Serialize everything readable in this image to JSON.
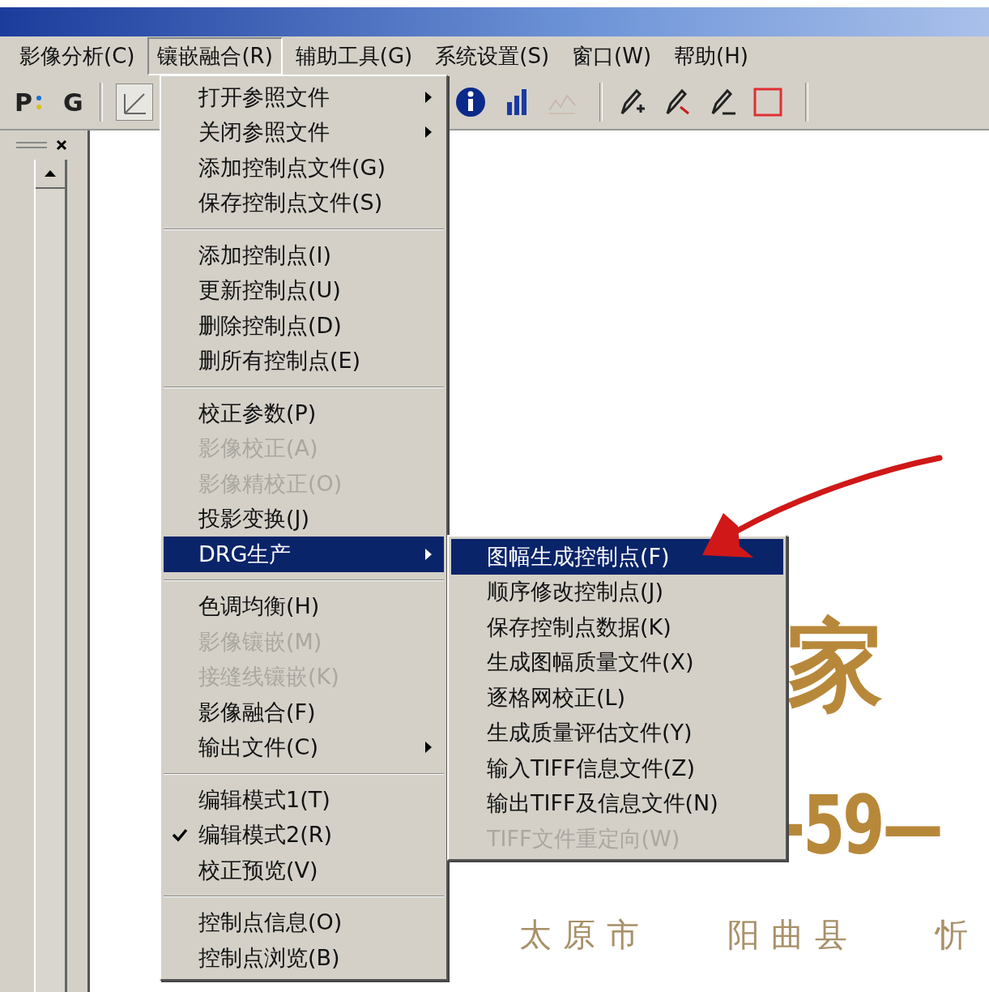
{
  "menu_bar": [
    {
      "label": "影像分析(C)",
      "selected": false
    },
    {
      "label": "镶嵌融合(R)",
      "selected": true
    },
    {
      "label": "辅助工具(G)",
      "selected": false
    },
    {
      "label": "系统设置(S)",
      "selected": false
    },
    {
      "label": "窗口(W)",
      "selected": false
    },
    {
      "label": "帮助(H)",
      "selected": false
    }
  ],
  "toolbar": {
    "text_buttons": [
      "P",
      "G"
    ]
  },
  "dropdown_menu": {
    "groups": [
      [
        {
          "label": "打开参照文件",
          "disabled": false,
          "checked": false,
          "selected": false,
          "has_submenu": true
        },
        {
          "label": "关闭参照文件",
          "disabled": false,
          "checked": false,
          "selected": false,
          "has_submenu": true
        },
        {
          "label": "添加控制点文件(G)",
          "disabled": false,
          "checked": false,
          "selected": false,
          "has_submenu": false
        },
        {
          "label": "保存控制点文件(S)",
          "disabled": false,
          "checked": false,
          "selected": false,
          "has_submenu": false
        }
      ],
      [
        {
          "label": "添加控制点(I)",
          "disabled": false,
          "checked": false,
          "selected": false,
          "has_submenu": false
        },
        {
          "label": "更新控制点(U)",
          "disabled": false,
          "checked": false,
          "selected": false,
          "has_submenu": false
        },
        {
          "label": "删除控制点(D)",
          "disabled": false,
          "checked": false,
          "selected": false,
          "has_submenu": false
        },
        {
          "label": "删所有控制点(E)",
          "disabled": false,
          "checked": false,
          "selected": false,
          "has_submenu": false
        }
      ],
      [
        {
          "label": "校正参数(P)",
          "disabled": false,
          "checked": false,
          "selected": false,
          "has_submenu": false
        },
        {
          "label": "影像校正(A)",
          "disabled": true,
          "checked": false,
          "selected": false,
          "has_submenu": false
        },
        {
          "label": "影像精校正(O)",
          "disabled": true,
          "checked": false,
          "selected": false,
          "has_submenu": false
        },
        {
          "label": "投影变换(J)",
          "disabled": false,
          "checked": false,
          "selected": false,
          "has_submenu": false
        },
        {
          "label": "DRG生产",
          "disabled": false,
          "checked": false,
          "selected": true,
          "has_submenu": true
        }
      ],
      [
        {
          "label": "色调均衡(H)",
          "disabled": false,
          "checked": false,
          "selected": false,
          "has_submenu": false
        },
        {
          "label": "影像镶嵌(M)",
          "disabled": true,
          "checked": false,
          "selected": false,
          "has_submenu": false
        },
        {
          "label": "接缝线镶嵌(K)",
          "disabled": true,
          "checked": false,
          "selected": false,
          "has_submenu": false
        },
        {
          "label": "影像融合(F)",
          "disabled": false,
          "checked": false,
          "selected": false,
          "has_submenu": false
        },
        {
          "label": "输出文件(C)",
          "disabled": false,
          "checked": false,
          "selected": false,
          "has_submenu": true
        }
      ],
      [
        {
          "label": "编辑模式1(T)",
          "disabled": false,
          "checked": false,
          "selected": false,
          "has_submenu": false
        },
        {
          "label": "编辑模式2(R)",
          "disabled": false,
          "checked": true,
          "selected": false,
          "has_submenu": false
        },
        {
          "label": "校正预览(V)",
          "disabled": false,
          "checked": false,
          "selected": false,
          "has_submenu": false
        }
      ],
      [
        {
          "label": "控制点信息(O)",
          "disabled": false,
          "checked": false,
          "selected": false,
          "has_submenu": false
        },
        {
          "label": "控制点浏览(B)",
          "disabled": false,
          "checked": false,
          "selected": false,
          "has_submenu": false
        }
      ]
    ]
  },
  "submenu": {
    "items": [
      {
        "label": "图幅生成控制点(F)",
        "disabled": false,
        "selected": true
      },
      {
        "label": "顺序修改控制点(J)",
        "disabled": false,
        "selected": false
      },
      {
        "label": "保存控制点数据(K)",
        "disabled": false,
        "selected": false
      },
      {
        "label": "生成图幅质量文件(X)",
        "disabled": false,
        "selected": false
      },
      {
        "label": "逐格网校正(L)",
        "disabled": false,
        "selected": false
      },
      {
        "label": "生成质量评估文件(Y)",
        "disabled": false,
        "selected": false
      },
      {
        "label": "输入TIFF信息文件(Z)",
        "disabled": false,
        "selected": false
      },
      {
        "label": "输出TIFF及信息文件(N)",
        "disabled": false,
        "selected": false
      },
      {
        "label": "TIFF文件重定向(W)",
        "disabled": true,
        "selected": false
      }
    ]
  },
  "map": {
    "title_char": "家",
    "sheet_number": "-59—",
    "place_names": [
      "太原市",
      "阳曲县",
      "忻"
    ]
  }
}
